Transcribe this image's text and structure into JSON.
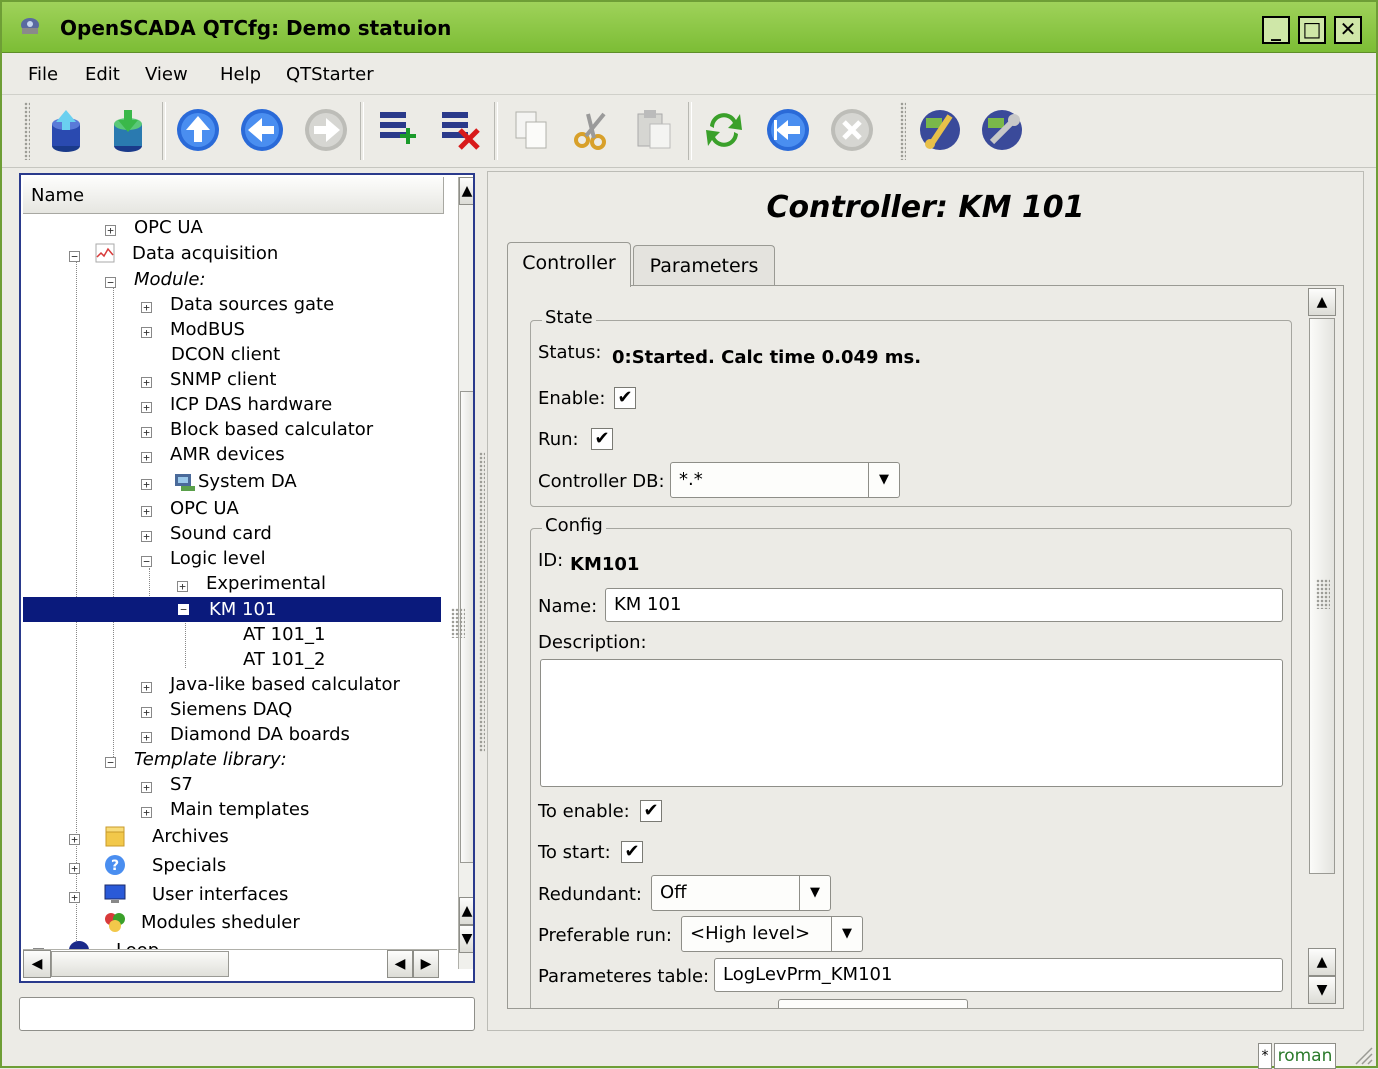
{
  "window": {
    "title": "OpenSCADA QTCfg: Demo statuion"
  },
  "menubar": [
    "File",
    "Edit",
    "View",
    "Help",
    "QTStarter"
  ],
  "toolbar": {
    "icons": [
      "db-load-icon",
      "db-save-icon",
      "up-icon",
      "back-icon",
      "forward-icon",
      "item-add-icon",
      "item-delete-icon",
      "copy-icon",
      "cut-icon",
      "paste-icon",
      "refresh-icon",
      "start-icon",
      "stop-icon",
      "station-icon",
      "station-config-icon"
    ]
  },
  "tree": {
    "header": "Name",
    "rows": [
      {
        "label": "OPC UA",
        "italic": false
      },
      {
        "label": "Data acquisition",
        "italic": false
      },
      {
        "label": "Module:",
        "italic": true
      },
      {
        "label": "Data sources gate",
        "italic": false
      },
      {
        "label": "ModBUS",
        "italic": false
      },
      {
        "label": "DCON client",
        "italic": false
      },
      {
        "label": "SNMP client",
        "italic": false
      },
      {
        "label": "ICP DAS hardware",
        "italic": false
      },
      {
        "label": "Block based calculator",
        "italic": false
      },
      {
        "label": "AMR devices",
        "italic": false
      },
      {
        "label": "System DA",
        "italic": false
      },
      {
        "label": "OPC UA",
        "italic": false
      },
      {
        "label": "Sound card",
        "italic": false
      },
      {
        "label": "Logic level",
        "italic": false
      },
      {
        "label": "Experimental",
        "italic": false
      },
      {
        "label": "KM 101",
        "italic": false
      },
      {
        "label": "AT 101_1",
        "italic": false
      },
      {
        "label": "AT 101_2",
        "italic": false
      },
      {
        "label": "Java-like based calculator",
        "italic": false
      },
      {
        "label": "Siemens DAQ",
        "italic": false
      },
      {
        "label": "Diamond DA boards",
        "italic": false
      },
      {
        "label": "Template library:",
        "italic": true
      },
      {
        "label": "S7",
        "italic": false
      },
      {
        "label": "Main templates",
        "italic": false
      },
      {
        "label": "Archives",
        "italic": false
      },
      {
        "label": "Specials",
        "italic": false
      },
      {
        "label": "User interfaces",
        "italic": false
      },
      {
        "label": "Modules sheduler",
        "italic": false
      },
      {
        "label": "Loop",
        "italic": false
      }
    ]
  },
  "page": {
    "title": "Controller: KM 101",
    "tabs": [
      "Controller",
      "Parameters"
    ],
    "state": {
      "group_title": "State",
      "status_label": "Status:",
      "status_value": "0:Started. Calc time 0.049 ms.",
      "enable_label": "Enable:",
      "run_label": "Run:",
      "db_label": "Controller DB:",
      "db_value": "*.*"
    },
    "config": {
      "group_title": "Config",
      "id_label": "ID:",
      "id_value": "KM101",
      "name_label": "Name:",
      "name_value": "KM 101",
      "description_label": "Description:",
      "description_value": "",
      "to_enable_label": "To enable:",
      "to_start_label": "To start:",
      "redundant_label": "Redundant:",
      "redundant_value": "Off",
      "pref_run_label": "Preferable run:",
      "pref_run_value": "<High level>",
      "param_table_label": "Parameteres table:",
      "param_table_value": "LogLevPrm_KM101"
    }
  },
  "statusbar": {
    "modified": "*",
    "user": "roman"
  }
}
